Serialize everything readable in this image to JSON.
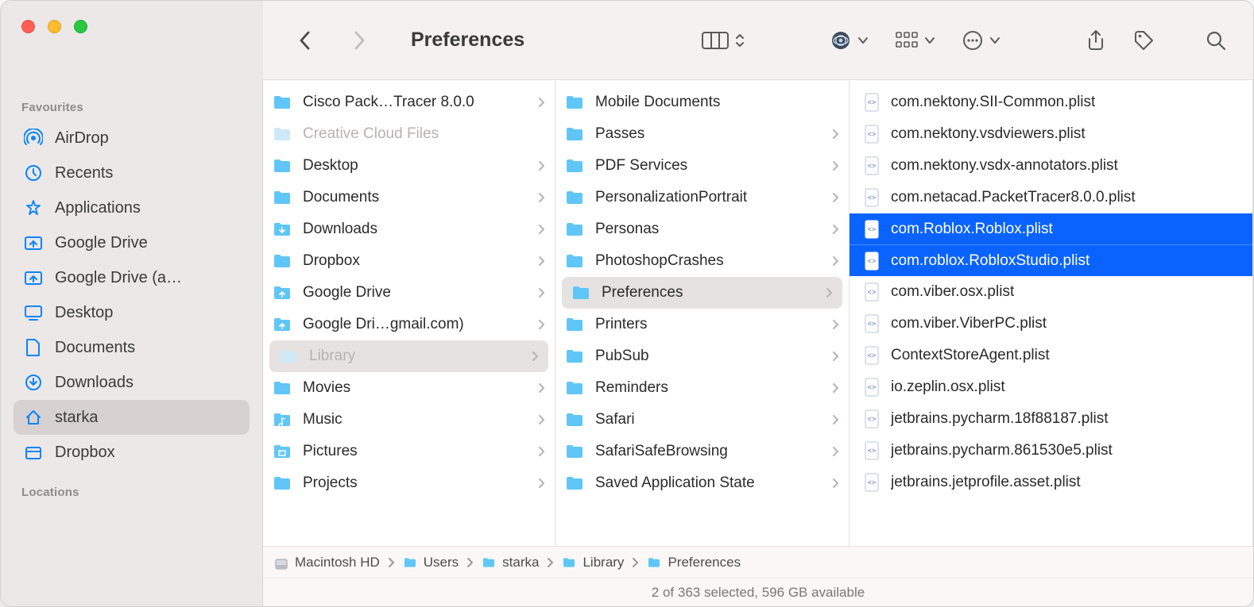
{
  "title": "Preferences",
  "sidebar": {
    "sections": [
      {
        "header": "Favourites",
        "items": [
          {
            "id": "airdrop",
            "label": "AirDrop",
            "icon": "airdrop"
          },
          {
            "id": "recents",
            "label": "Recents",
            "icon": "clock"
          },
          {
            "id": "applications",
            "label": "Applications",
            "icon": "apps"
          },
          {
            "id": "gdrive1",
            "label": "Google Drive",
            "icon": "drive"
          },
          {
            "id": "gdrive2",
            "label": "Google Drive (a…",
            "icon": "drive"
          },
          {
            "id": "desktop",
            "label": "Desktop",
            "icon": "desktop"
          },
          {
            "id": "documents",
            "label": "Documents",
            "icon": "doc"
          },
          {
            "id": "downloads",
            "label": "Downloads",
            "icon": "download"
          },
          {
            "id": "home",
            "label": "starka",
            "icon": "home",
            "selected": true
          },
          {
            "id": "dropbox",
            "label": "Dropbox",
            "icon": "box"
          }
        ]
      },
      {
        "header": "Locations",
        "items": []
      }
    ]
  },
  "columns": [
    [
      {
        "name": "Cisco Pack…Tracer 8.0.0",
        "type": "folder",
        "chev": true
      },
      {
        "name": "Creative Cloud Files",
        "type": "folder",
        "chev": false,
        "dim": true
      },
      {
        "name": "Desktop",
        "type": "folder",
        "chev": true
      },
      {
        "name": "Documents",
        "type": "folder",
        "chev": true
      },
      {
        "name": "Downloads",
        "type": "folder",
        "chev": true,
        "badge": "down"
      },
      {
        "name": "Dropbox",
        "type": "folder",
        "chev": true
      },
      {
        "name": "Google Drive",
        "type": "folder",
        "chev": true,
        "badge": "up"
      },
      {
        "name": "Google Dri…gmail.com)",
        "type": "folder",
        "chev": true,
        "badge": "up"
      },
      {
        "name": "Library",
        "type": "folder",
        "chev": true,
        "dim": true,
        "navSelected": true
      },
      {
        "name": "Movies",
        "type": "folder",
        "chev": true
      },
      {
        "name": "Music",
        "type": "folder",
        "chev": true,
        "badge": "music"
      },
      {
        "name": "Pictures",
        "type": "folder",
        "chev": true,
        "badge": "pic"
      },
      {
        "name": "Projects",
        "type": "folder",
        "chev": true
      }
    ],
    [
      {
        "name": "Mobile Documents",
        "type": "folder",
        "chev": false
      },
      {
        "name": "Passes",
        "type": "folder",
        "chev": true
      },
      {
        "name": "PDF Services",
        "type": "folder",
        "chev": true
      },
      {
        "name": "PersonalizationPortrait",
        "type": "folder",
        "chev": true
      },
      {
        "name": "Personas",
        "type": "folder",
        "chev": true
      },
      {
        "name": "PhotoshopCrashes",
        "type": "folder",
        "chev": true
      },
      {
        "name": "Preferences",
        "type": "folder",
        "chev": true,
        "navSelected": true
      },
      {
        "name": "Printers",
        "type": "folder",
        "chev": true
      },
      {
        "name": "PubSub",
        "type": "folder",
        "chev": true
      },
      {
        "name": "Reminders",
        "type": "folder",
        "chev": true
      },
      {
        "name": "Safari",
        "type": "folder",
        "chev": true
      },
      {
        "name": "SafariSafeBrowsing",
        "type": "folder",
        "chev": true
      },
      {
        "name": "Saved Application State",
        "type": "folder",
        "chev": true
      }
    ],
    [
      {
        "name": "com.nektony.SII-Common.plist",
        "type": "file"
      },
      {
        "name": "com.nektony.vsdviewers.plist",
        "type": "file"
      },
      {
        "name": "com.nektony.vsdx-annotators.plist",
        "type": "file"
      },
      {
        "name": "com.netacad.PacketTracer8.0.0.plist",
        "type": "file"
      },
      {
        "name": "com.Roblox.Roblox.plist",
        "type": "file",
        "selected": true
      },
      {
        "name": "com.roblox.RobloxStudio.plist",
        "type": "file",
        "selected": true
      },
      {
        "name": "com.viber.osx.plist",
        "type": "file"
      },
      {
        "name": "com.viber.ViberPC.plist",
        "type": "file"
      },
      {
        "name": "ContextStoreAgent.plist",
        "type": "file"
      },
      {
        "name": "io.zeplin.osx.plist",
        "type": "file"
      },
      {
        "name": "jetbrains.pycharm.18f88187.plist",
        "type": "file"
      },
      {
        "name": "jetbrains.pycharm.861530e5.plist",
        "type": "file"
      },
      {
        "name": "jetbrains.jetprofile.asset.plist",
        "type": "file"
      }
    ]
  ],
  "path": [
    {
      "name": "Macintosh HD",
      "icon": "disk"
    },
    {
      "name": "Users",
      "icon": "folder"
    },
    {
      "name": "starka",
      "icon": "folder"
    },
    {
      "name": "Library",
      "icon": "folder"
    },
    {
      "name": "Preferences",
      "icon": "folder"
    }
  ],
  "status": "2 of 363 selected, 596 GB available"
}
